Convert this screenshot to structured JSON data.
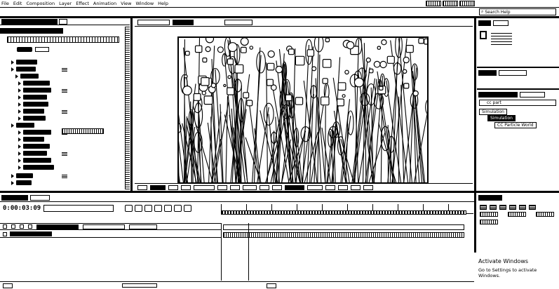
{
  "menu": [
    "File",
    "Edit",
    "Composition",
    "Layer",
    "Effect",
    "Animation",
    "View",
    "Window",
    "Help"
  ],
  "search_help": {
    "placeholder": "Search Help"
  },
  "effect_controls": {
    "properties": [
      "",
      "",
      "",
      "",
      "",
      "",
      "",
      "",
      "",
      "",
      "",
      "",
      "",
      "",
      "",
      ""
    ]
  },
  "effects_presets": {
    "search_value": "cc part",
    "category": "Simulation",
    "selected_group": "Simulation",
    "effect": "CC Particle World"
  },
  "timeline": {
    "timecode": "0:00:03:09"
  },
  "activate_windows": {
    "title": "Activate Windows",
    "subtitle": "Go to Settings to activate Windows."
  },
  "colors": {
    "ink": "#000000",
    "paper": "#ffffff"
  }
}
